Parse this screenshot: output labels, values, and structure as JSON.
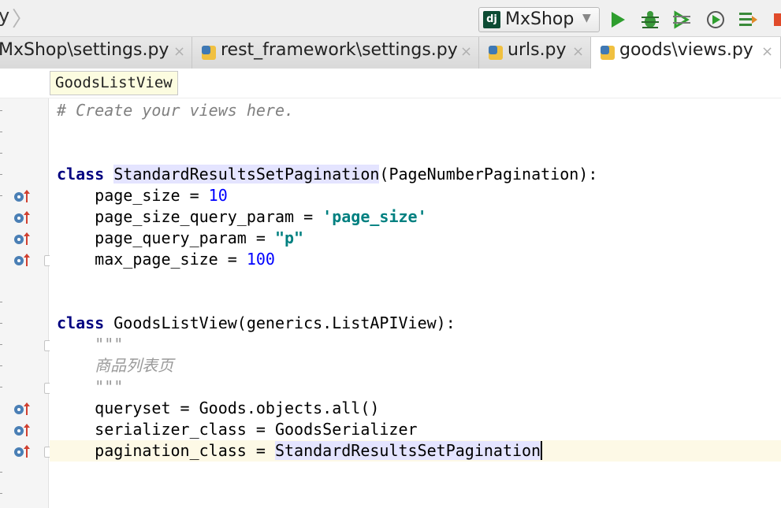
{
  "toolbar": {
    "crumb_fragment": "y",
    "run_config": "MxShop",
    "dj_badge": "dj",
    "buttons": [
      "run-icon",
      "debug-icon",
      "coverage-icon",
      "profile-icon",
      "build-icon",
      "stop-icon"
    ]
  },
  "tabs": [
    {
      "label": "MxShop\\settings.py",
      "close": "×",
      "icon": "none",
      "active": false
    },
    {
      "label": "rest_framework\\settings.py",
      "close": "×",
      "icon": "python-file-icon",
      "active": false
    },
    {
      "label": "urls.py",
      "close": "×",
      "icon": "python-file-icon",
      "active": false
    },
    {
      "label": "goods\\views.py",
      "close": "×",
      "icon": "python-file-icon",
      "active": true
    }
  ],
  "breadcrumb": {
    "label": "GoodsListView"
  },
  "code": {
    "comment": "# Create your views here.",
    "class1": {
      "kw": "class",
      "name": "StandardResultsSetPagination",
      "base": "(PageNumberPagination):",
      "attrs": [
        {
          "name": "    page_size = ",
          "value": "10",
          "kind": "num"
        },
        {
          "name": "    page_size_query_param = ",
          "value": "'page_size'",
          "kind": "str"
        },
        {
          "name": "    page_query_param = ",
          "value": "\"p\"",
          "kind": "str"
        },
        {
          "name": "    max_page_size = ",
          "value": "100",
          "kind": "num"
        }
      ]
    },
    "class2": {
      "kw": "class",
      "rest": " GoodsListView(generics.ListAPIView):",
      "doc_open": "    \"\"\"",
      "doc_text": "    商品列表页",
      "doc_close": "    \"\"\"",
      "line1": "    queryset = Goods.objects.all()",
      "line2": "    serializer_class = GoodsSerializer",
      "line3_prefix": "    pagination_class = ",
      "line3_value": "StandardResultsSetPagination"
    }
  },
  "colors": {
    "keyword": "#000080",
    "number": "#0000ff",
    "string": "#008080",
    "comment": "#808080",
    "current_line": "#fdf9e6",
    "run_green": "#2e9e2e",
    "stop_red": "#e04a2a"
  }
}
